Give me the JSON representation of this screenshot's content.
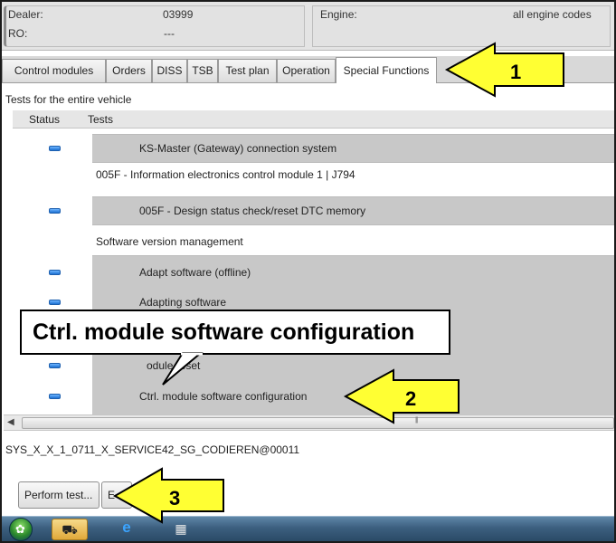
{
  "header": {
    "dealer_label": "Dealer:",
    "dealer_value": "03999",
    "ro_label": "RO:",
    "ro_value": "---",
    "engine_label": "Engine:",
    "engine_value": "all engine codes"
  },
  "tabs": [
    {
      "label": "Control modules"
    },
    {
      "label": "Orders"
    },
    {
      "label": "DISS"
    },
    {
      "label": "TSB"
    },
    {
      "label": "Test plan"
    },
    {
      "label": "Operation"
    },
    {
      "label": "Special Functions",
      "active": true
    }
  ],
  "section_title": "Tests for the entire vehicle",
  "table": {
    "headers": [
      "Status",
      "Tests"
    ],
    "rows": [
      {
        "type": "test",
        "label": "KS-Master (Gateway) connection system",
        "status": "blue"
      },
      {
        "type": "group",
        "label": "005F - Information electronics control module 1 | J794"
      },
      {
        "type": "test",
        "label": "005F - Design status check/reset DTC memory",
        "status": "blue"
      },
      {
        "type": "group",
        "label": "Software version management"
      },
      {
        "type": "test",
        "label": "Adapt software (offline)",
        "status": "blue"
      },
      {
        "type": "test",
        "label": "Adapting software",
        "status": "blue"
      },
      {
        "type": "test",
        "label": "Ctrl. module reset",
        "status": "blue",
        "visible_label": "odule reset"
      },
      {
        "type": "test",
        "label": "Ctrl. module software configuration",
        "status": "blue"
      }
    ]
  },
  "status_line": "SYS_X_X_1_0711_X_SERVICE42_SG_CODIEREN@00011",
  "buttons": {
    "perform_test": "Perform test...",
    "second": "E"
  },
  "taskbar": {
    "icons": [
      "start-orb-icon",
      "vas-app-icon",
      "internet-explorer-icon",
      "keyboard-grid-icon"
    ]
  },
  "annotations": {
    "callout_text": "Ctrl. module software configuration",
    "arrow_1": "1",
    "arrow_2": "2",
    "arrow_3": "3",
    "arrow_color": "#ffff33"
  }
}
